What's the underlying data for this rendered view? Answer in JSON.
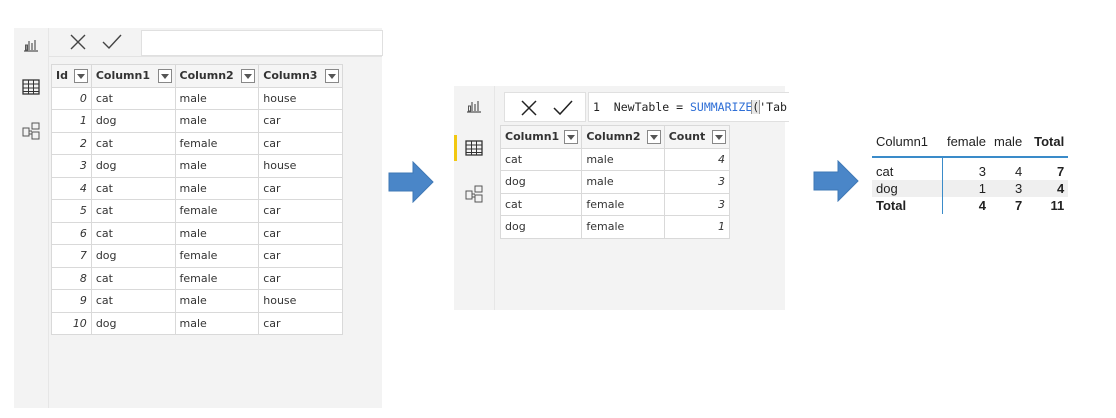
{
  "source_table": {
    "columns": [
      "Id",
      "Column1",
      "Column2",
      "Column3"
    ],
    "rows": [
      [
        "0",
        "cat",
        "male",
        "house"
      ],
      [
        "1",
        "dog",
        "male",
        "car"
      ],
      [
        "2",
        "cat",
        "female",
        "car"
      ],
      [
        "3",
        "dog",
        "male",
        "house"
      ],
      [
        "4",
        "cat",
        "male",
        "car"
      ],
      [
        "5",
        "cat",
        "female",
        "car"
      ],
      [
        "6",
        "cat",
        "male",
        "car"
      ],
      [
        "7",
        "dog",
        "female",
        "car"
      ],
      [
        "8",
        "cat",
        "female",
        "car"
      ],
      [
        "9",
        "cat",
        "male",
        "house"
      ],
      [
        "10",
        "dog",
        "male",
        "car"
      ]
    ]
  },
  "formula": {
    "line_number": "1",
    "prefix": "NewTable = ",
    "function": "SUMMARIZE",
    "paren": "(",
    "rest": "'Tab"
  },
  "summary_table": {
    "columns": [
      "Column1",
      "Column2",
      "Count"
    ],
    "rows": [
      [
        "cat",
        "male",
        "4"
      ],
      [
        "dog",
        "male",
        "3"
      ],
      [
        "cat",
        "female",
        "3"
      ],
      [
        "dog",
        "female",
        "1"
      ]
    ]
  },
  "matrix": {
    "row_header": "Column1",
    "col_headers": [
      "female",
      "male"
    ],
    "total_label": "Total",
    "rows": [
      {
        "label": "cat",
        "values": [
          "3",
          "4"
        ],
        "total": "7"
      },
      {
        "label": "dog",
        "values": [
          "1",
          "3"
        ],
        "total": "4"
      }
    ],
    "totals": {
      "label": "Total",
      "values": [
        "4",
        "7"
      ],
      "total": "11"
    }
  },
  "icons": {
    "cancel": "x-icon",
    "commit": "check-icon",
    "report_view": "bar-chart-icon",
    "data_view": "table-icon",
    "model_view": "model-icon",
    "arrow": "right-arrow-icon"
  },
  "colors": {
    "arrow": "#4a86c8",
    "accent": "#f2c811",
    "matrix_line": "#3a8bc9"
  }
}
